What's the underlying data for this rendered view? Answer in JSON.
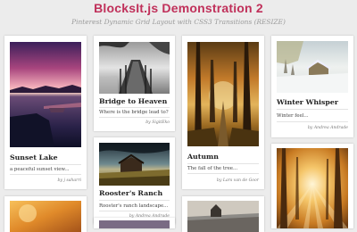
{
  "page": {
    "title": "BlocksIt.js Demonstration 2",
    "subtitle": "Pinterest Dynamic Grid Layout with CSS3 Transitions (RESIZE)"
  },
  "cards": [
    {
      "title": "Sunset Lake",
      "description": "a peaceful sunset view...",
      "author": "by j saharri",
      "photo": "sunset-lake-photo"
    },
    {
      "title": "Bridge to Heaven",
      "description": "Where is the bridge lead to?",
      "author": "by SigitEko",
      "photo": "bridge-photo"
    },
    {
      "title": "Rooster's Ranch",
      "description": "Rooster's ranch landscape...",
      "author": "by Andrea Andrade",
      "photo": "ranch-photo"
    },
    {
      "title": "Autumn",
      "description": "The fall of the tree...",
      "author": "by Lars van de Goor",
      "photo": "autumn-photo"
    },
    {
      "title": "Winter Whisper",
      "description": "Winter feel...",
      "author": "by Andrea Andrade",
      "photo": "winter-photo"
    },
    {
      "title": "",
      "description": "",
      "author": "",
      "photo": "orange-field-photo"
    },
    {
      "title": "",
      "description": "",
      "author": "",
      "photo": "fields-photo"
    },
    {
      "title": "",
      "description": "",
      "author": "",
      "photo": "dusk-photo"
    },
    {
      "title": "",
      "description": "",
      "author": "",
      "photo": "sunlit-forest-photo"
    }
  ]
}
